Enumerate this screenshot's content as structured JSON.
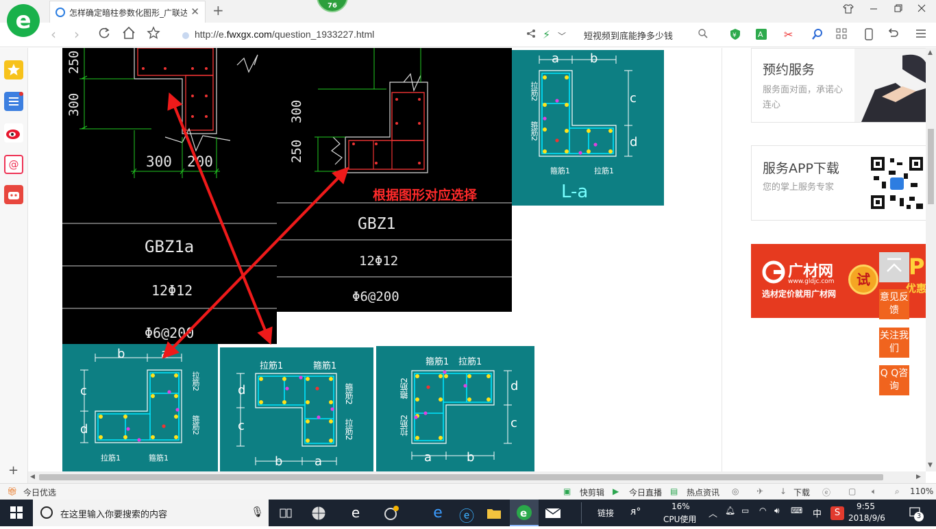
{
  "browser": {
    "badge_count": "76",
    "tab_title": "怎样确定暗柱参数化图形_广联达",
    "tab_close": "✕",
    "new_tab": "+",
    "url_prefix": "http://e.",
    "url_domain": "fwxgx.com",
    "url_path": "/question_1933227.html",
    "hot_search": "短视频到底能挣多少钱"
  },
  "cad_left": {
    "dim_top": "250",
    "dim_mid": "300",
    "dim_b1": "300",
    "dim_b2": "200",
    "name": "GBZ1a",
    "rebar": "12Φ12",
    "stirrup": "Φ6@200"
  },
  "cad_right": {
    "dim_top": "300",
    "dim_bot": "250",
    "hint": "根据图形对应选择",
    "name": "GBZ1",
    "rebar": "12Φ12",
    "stirrup": "Φ6@200"
  },
  "diagram_la": {
    "a": "a",
    "b": "b",
    "c": "c",
    "d": "d",
    "tie2": "拉筋2",
    "hoop2": "箍筋2",
    "hoop1": "箍筋1",
    "tie1": "拉筋1",
    "caption": "L-a"
  },
  "diagram_b1": {
    "a": "a",
    "b": "b",
    "c": "c",
    "d": "d",
    "tie2": "拉筋2",
    "hoop2": "箍筋2",
    "tie1": "拉筋1",
    "hoop1": "箍筋1"
  },
  "diagram_b2": {
    "a": "a",
    "b": "b",
    "c": "c",
    "d": "d",
    "tie1": "拉筋1",
    "hoop1": "箍筋1",
    "hoop2": "箍筋2",
    "tie2": "拉筋2"
  },
  "diagram_b3": {
    "a": "a",
    "b": "b",
    "c": "c",
    "d": "d",
    "hoop1": "箍筋1",
    "tie1": "拉筋1",
    "hoop2": "箍筋2",
    "tie2": "拉筋2"
  },
  "right": {
    "service_title": "预约服务",
    "service_sub": "服务面对面，承诺心连心",
    "app_title": "服务APP下载",
    "app_sub": "您的掌上服务专家",
    "ad_brand": "广材网",
    "ad_site": "www.gldjc.com",
    "ad_slogan": "选材定价就用广材网",
    "ad_try": "试",
    "ad_right": "优惠试用",
    "feedback": "意见反馈",
    "follow": "关注我们",
    "qq": "Q Q咨询"
  },
  "statusbar": {
    "today": "今日优选",
    "kuaijian": "快剪辑",
    "live": "今日直播",
    "news": "热点资讯",
    "download": "下载",
    "zoom": "110%"
  },
  "taskbar": {
    "search_placeholder": "在这里输入你要搜索的内容",
    "link": "链接",
    "cpu": "16%",
    "cpu_label": "CPU使用",
    "ime": "中",
    "time": "9:55",
    "date": "2018/9/6",
    "notif": "3"
  }
}
